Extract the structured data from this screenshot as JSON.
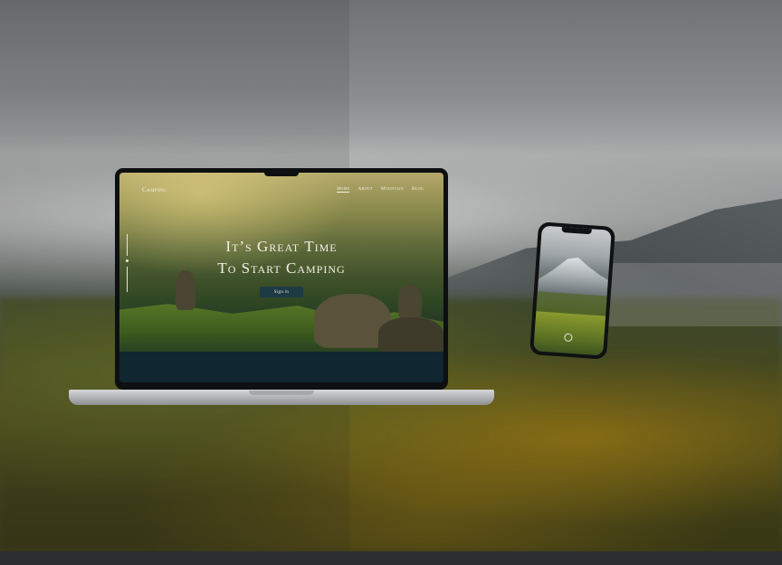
{
  "site": {
    "logo": "Camping",
    "nav": [
      {
        "label": "Home",
        "active": true
      },
      {
        "label": "About",
        "active": false
      },
      {
        "label": "Mountain",
        "active": false
      },
      {
        "label": "Blog",
        "active": false
      }
    ],
    "hero": {
      "line1": "It’s Great Time",
      "line2": "To Start Camping",
      "button": "Sign in"
    }
  },
  "colors": {
    "hero_text": "#f3f0e6",
    "button_bg": "#1d3a45",
    "footer_bg": "#102630"
  }
}
